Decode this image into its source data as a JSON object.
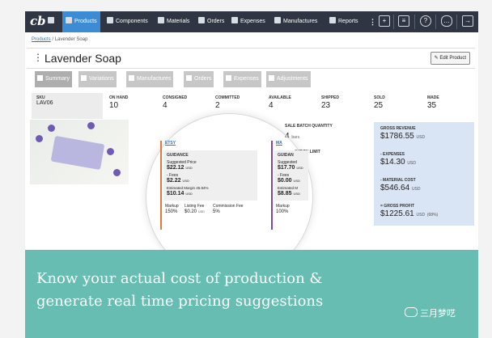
{
  "app": {
    "logo": "cb"
  },
  "nav": {
    "items": [
      {
        "label": "Products"
      },
      {
        "label": "Components"
      },
      {
        "label": "Materials"
      },
      {
        "label": "Orders"
      },
      {
        "label": "Expenses"
      },
      {
        "label": "Manufactures"
      },
      {
        "label": "Reports"
      }
    ],
    "icons": [
      "more-icon",
      "add-icon",
      "settings-icon",
      "help-icon",
      "chat-icon",
      "logout-icon"
    ]
  },
  "breadcrumb": {
    "root": "Products",
    "separator": "/",
    "current": "Lavender Soap"
  },
  "page": {
    "title": "Lavender Soap",
    "edit_button": "Edit Product"
  },
  "tabs": [
    {
      "label": "Summary"
    },
    {
      "label": "Variations"
    },
    {
      "label": "Manufactures"
    },
    {
      "label": "Orders"
    },
    {
      "label": "Expenses"
    },
    {
      "label": "Adjustments"
    }
  ],
  "stats": {
    "sku_label": "SKU",
    "sku_value": "LAV06",
    "on_hand_label": "ON HAND",
    "on_hand_value": "10",
    "consigned_label": "CONSIGNED",
    "consigned_value": "4",
    "committed_label": "COMMITTED",
    "committed_value": "2",
    "available_label": "AVAILABLE",
    "available_value": "4",
    "shipped_label": "SHIPPED",
    "shipped_value": "23",
    "sold_label": "SOLD",
    "sold_value": "25",
    "made_label": "MADE",
    "made_value": "35"
  },
  "sale": {
    "batch_label": "SALE BATCH QUANTITY",
    "batch_value": "4",
    "batch_unit": "bars",
    "stock_label": "STOCK LIMIT"
  },
  "etsy": {
    "channel": "ETSY",
    "guidance_title": "GUIDANCE",
    "suggested_price_label": "Suggested Price",
    "suggested_price_value": "$22.12",
    "suggested_price_unit": "USD",
    "fees_label": "- Fees",
    "fees_value": "$2.22",
    "fees_unit": "USD",
    "margin_label": "Estimated Margin 45.84%",
    "margin_value": "$10.14",
    "margin_unit": "USD",
    "markup_label": "Markup",
    "markup_value": "150%",
    "listing_fee_label": "Listing Fee",
    "listing_fee_value": "$0.20",
    "listing_fee_unit": "USD",
    "commission_label": "Commission Fee",
    "commission_value": "5%"
  },
  "second": {
    "channel": "MA",
    "guidance_title": "GUIDAN",
    "suggested_price_label": "Suggested",
    "suggested_price_value": "$17.70",
    "suggested_price_unit": "USD",
    "fees_label": "- Fees",
    "fees_value": "$0.00",
    "fees_unit": "USD",
    "margin_label": "Estimated M",
    "margin_value": "$8.85",
    "margin_unit": "USD",
    "markup_label": "Markup",
    "markup_value": "100%"
  },
  "finance": {
    "gross_revenue_label": "GROSS REVENUE",
    "gross_revenue_value": "$1786.55",
    "expenses_label": "- EXPENSES",
    "expenses_value": "$14.30",
    "material_cost_label": "- MATERIAL COST",
    "material_cost_value": "$546.64",
    "gross_profit_label": "= GROSS PROFIT",
    "gross_profit_value": "$1225.61",
    "gross_profit_pct": "(68%)",
    "currency": "USD"
  },
  "banner": {
    "line1": "Know your actual cost of production &",
    "line2": "generate real time pricing suggestions"
  },
  "watermark": {
    "text": "三月梦呓"
  },
  "colors": {
    "nav": "#2f3542",
    "accent": "#3d8bd3",
    "banner": "#68bdb2",
    "etsy": "#e07a3f",
    "channel2": "#7d45b8"
  }
}
